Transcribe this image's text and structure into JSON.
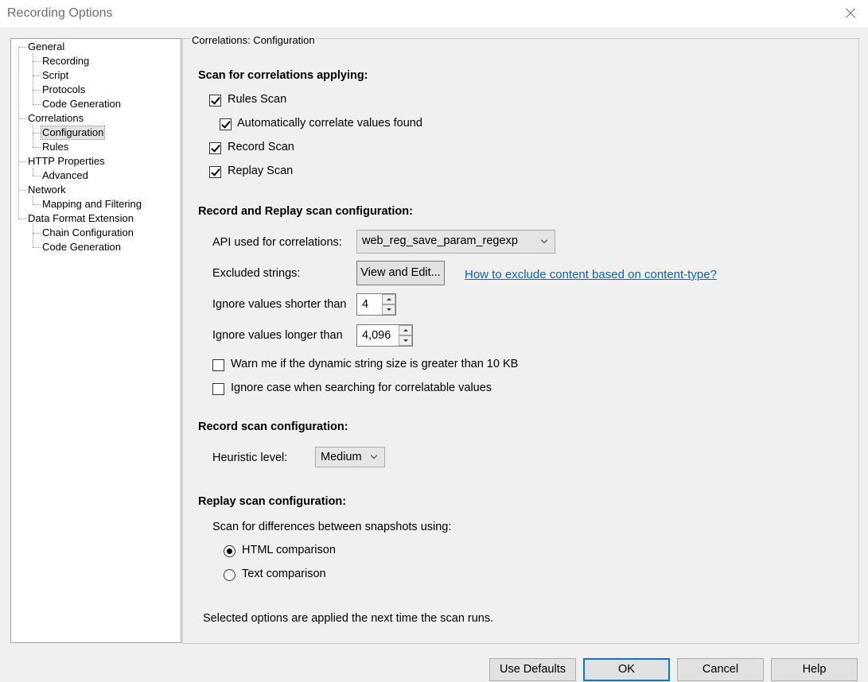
{
  "window": {
    "title": "Recording Options"
  },
  "tree": {
    "items": [
      {
        "label": "General"
      },
      {
        "label": "Recording"
      },
      {
        "label": "Script"
      },
      {
        "label": "Protocols"
      },
      {
        "label": "Code Generation"
      },
      {
        "label": "Correlations"
      },
      {
        "label": "Configuration",
        "selected": true
      },
      {
        "label": "Rules"
      },
      {
        "label": "HTTP Properties"
      },
      {
        "label": "Advanced"
      },
      {
        "label": "Network"
      },
      {
        "label": "Mapping and Filtering"
      },
      {
        "label": "Data Format Extension"
      },
      {
        "label": "Chain Configuration"
      },
      {
        "label": "Code Generation"
      }
    ]
  },
  "panel": {
    "legend": "Correlations: Configuration",
    "scan_section": {
      "heading": "Scan for correlations applying:",
      "rules_scan": {
        "label": "Rules Scan",
        "checked": true
      },
      "auto_correlate": {
        "label": "Automatically correlate values found",
        "checked": true
      },
      "record_scan": {
        "label": "Record Scan",
        "checked": true
      },
      "replay_scan": {
        "label": "Replay Scan",
        "checked": true
      }
    },
    "record_replay_section": {
      "heading": "Record and Replay scan configuration:",
      "api_label": "API used for correlations:",
      "api_value": "web_reg_save_param_regexp",
      "excluded_label": "Excluded strings:",
      "view_edit_button": "View and Edit...",
      "exclude_link": "How to exclude content based on content-type?",
      "shorter_label": "Ignore values shorter than",
      "shorter_value": "4",
      "longer_label": "Ignore values longer than",
      "longer_value": "4,096",
      "warn_size": {
        "label": "Warn me if the dynamic string size is greater than 10 KB",
        "checked": false
      },
      "ignore_case": {
        "label": "Ignore case when searching for correlatable values",
        "checked": false
      }
    },
    "record_section": {
      "heading": "Record scan configuration:",
      "heuristic_label": "Heuristic level:",
      "heuristic_value": "Medium"
    },
    "replay_section": {
      "heading": "Replay scan configuration:",
      "diff_label": "Scan for differences between snapshots using:",
      "html_comparison": {
        "label": "HTML comparison",
        "selected": true
      },
      "text_comparison": {
        "label": "Text comparison",
        "selected": false
      }
    },
    "footer_note": "Selected options are applied the next time the scan runs."
  },
  "buttons": {
    "use_defaults": "Use Defaults",
    "ok": "OK",
    "cancel": "Cancel",
    "help": "Help"
  },
  "colors": {
    "link": "#0066cc",
    "default_button_border": "#0078d7"
  }
}
